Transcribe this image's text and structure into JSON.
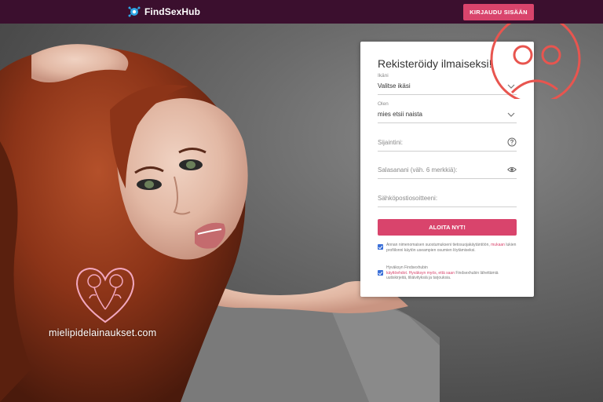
{
  "header": {
    "logo_text": "FindSexHub",
    "login_label": "KIRJAUDU SISÄÄN"
  },
  "form": {
    "title": "Rekisteröidy ilmaiseksi!",
    "age": {
      "label": "Ikäni",
      "value": "Valitse ikäsi"
    },
    "gender": {
      "label": "Olen",
      "value": "mies etsii naista"
    },
    "location": {
      "placeholder": "Sijaintini:"
    },
    "password": {
      "placeholder": "Salasanani (väh. 6 merkkiä):"
    },
    "email": {
      "placeholder": "Sähköpostiosoitteeni:"
    },
    "submit_label": "ALOITA NYT!",
    "consent1": {
      "text_before": "Annan nimenomaisen suostumukseni tietosuojakäytäntöön,",
      "link": "mukaan",
      "text_after": "lukien profiilonni käytön useampien osumien löytämiseksi."
    },
    "consent2": {
      "text_before": "Hyväksyn Findsexhubin",
      "link1": "käyttöehdot",
      "link2": "Hyväksyn myös, että saan",
      "text_after": "Findsexhubin lähettämiä uutiskirjeitä, tiliäivityksiä ja tarjouksia."
    }
  },
  "watermark": {
    "text": "mielipidelainaukset.com"
  },
  "colors": {
    "header_bg": "#3b0f2e",
    "accent": "#d9446c",
    "checkbox": "#3a6fd8",
    "overlay_red": "#e8554f"
  },
  "icons": [
    "logo-icon",
    "chevron-down-icon",
    "question-circle-icon",
    "eye-icon",
    "checkbox-checked-icon",
    "sad-face-icon",
    "rose-heart-icon"
  ]
}
